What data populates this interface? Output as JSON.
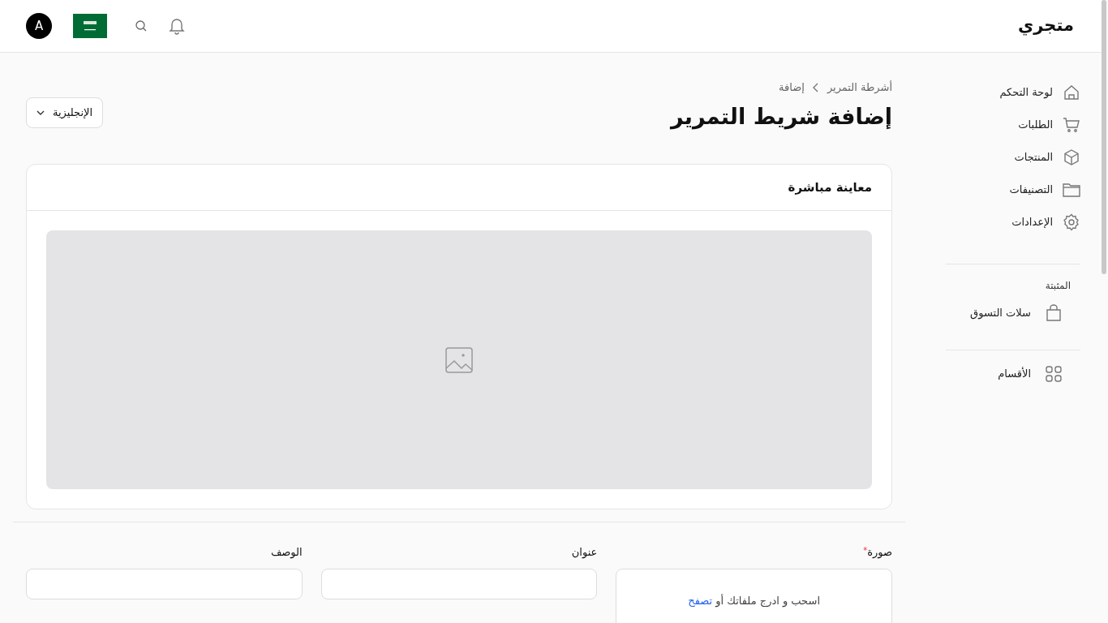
{
  "header": {
    "logo": "متجري",
    "avatar": "A"
  },
  "sidebar": {
    "items": [
      {
        "label": "لوحة التحكم"
      },
      {
        "label": "الطلبات"
      },
      {
        "label": "المنتجات"
      },
      {
        "label": "التصنيفات"
      },
      {
        "label": "الإعدادات"
      }
    ],
    "pinned_heading": "المثبتة",
    "pinned": [
      {
        "label": "سلات التسوق"
      }
    ],
    "sections": [
      {
        "label": "الأقسام"
      }
    ]
  },
  "breadcrumb": [
    "أشرطة التمرير",
    "إضافة"
  ],
  "page_title": "إضافة شريط التمرير",
  "language_select": "الإنجليزية",
  "preview": {
    "title": "معاينة مباشرة"
  },
  "form": {
    "image": {
      "label": "صورة",
      "required_mark": "*",
      "hint": "اسحب و ادرج ملفاتك أو",
      "link": "تصفح"
    },
    "title": {
      "label": "عنوان"
    },
    "description": {
      "label": "الوصف"
    }
  }
}
